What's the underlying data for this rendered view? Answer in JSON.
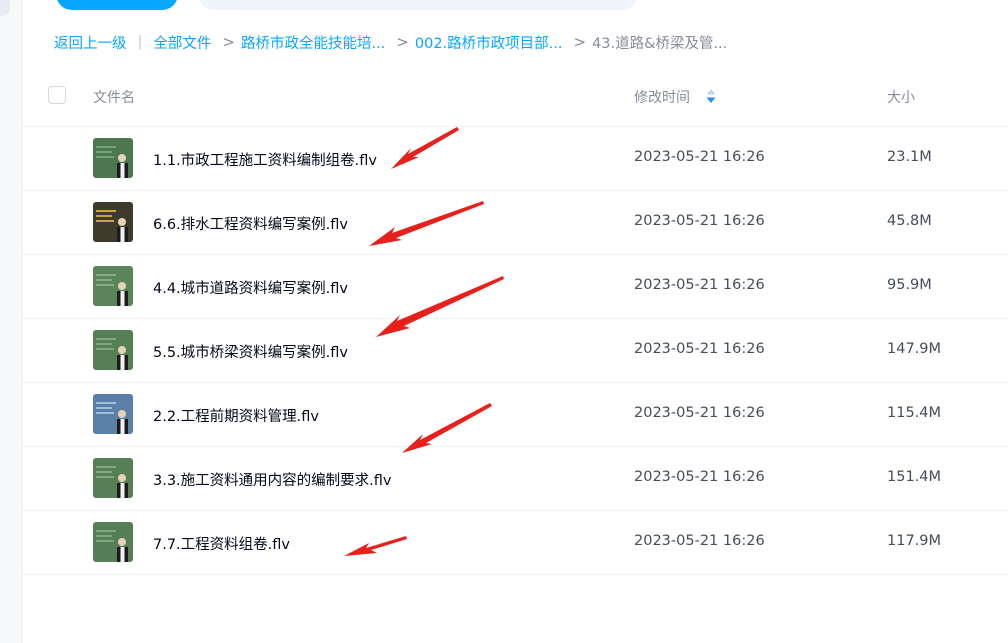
{
  "breadcrumb": {
    "back": "返回上一级",
    "all_files": "全部文件",
    "level1": "路桥市政全能技能培...",
    "level2": "002.路桥市政项目部...",
    "current": "43.道路&桥梁及管..."
  },
  "table": {
    "col_name": "文件名",
    "col_modified": "修改时间",
    "col_size": "大小"
  },
  "files": [
    {
      "name": "1.1.市政工程施工资料编制组卷.flv",
      "modified": "2023-05-21 16:26",
      "size": "23.1M"
    },
    {
      "name": "6.6.排水工程资料编写案例.flv",
      "modified": "2023-05-21 16:26",
      "size": "45.8M"
    },
    {
      "name": "4.4.城市道路资料编写案例.flv",
      "modified": "2023-05-21 16:26",
      "size": "95.9M"
    },
    {
      "name": "5.5.城市桥梁资料编写案例.flv",
      "modified": "2023-05-21 16:26",
      "size": "147.9M"
    },
    {
      "name": "2.2.工程前期资料管理.flv",
      "modified": "2023-05-21 16:26",
      "size": "115.4M"
    },
    {
      "name": "3.3.施工资料通用内容的编制要求.flv",
      "modified": "2023-05-21 16:26",
      "size": "151.4M"
    },
    {
      "name": "7.7.工程资料组卷.flv",
      "modified": "2023-05-21 16:26",
      "size": "117.9M"
    }
  ],
  "icons": {
    "sort": "sort-icon",
    "thumbnail": "video-thumbnail",
    "annotation": "red-arrow"
  },
  "colors": {
    "accent": "#06a7ff",
    "annotation": "#e8201c",
    "thumb_bg": "#4f7a4f"
  }
}
